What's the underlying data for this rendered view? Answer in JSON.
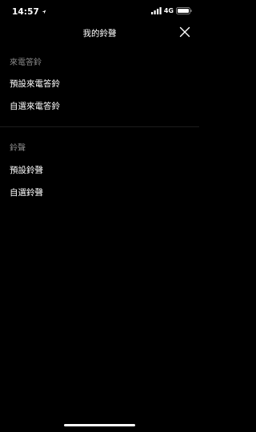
{
  "status_bar": {
    "time": "14:57",
    "network": "4G"
  },
  "header": {
    "title": "我的鈴聲"
  },
  "sections": [
    {
      "title": "來電答鈴",
      "items": [
        "預設來電答鈴",
        "自選來電答鈴"
      ]
    },
    {
      "title": "鈴聲",
      "items": [
        "預設鈴聲",
        "自選鈴聲"
      ]
    }
  ],
  "icons": {
    "location": "location-arrow-icon",
    "signal": "signal-bars-icon",
    "battery": "battery-icon",
    "close": "close-icon"
  },
  "colors": {
    "background": "#000000",
    "text": "#ffffff",
    "section_header": "#8c8c8c",
    "divider": "#1c1c1c"
  }
}
